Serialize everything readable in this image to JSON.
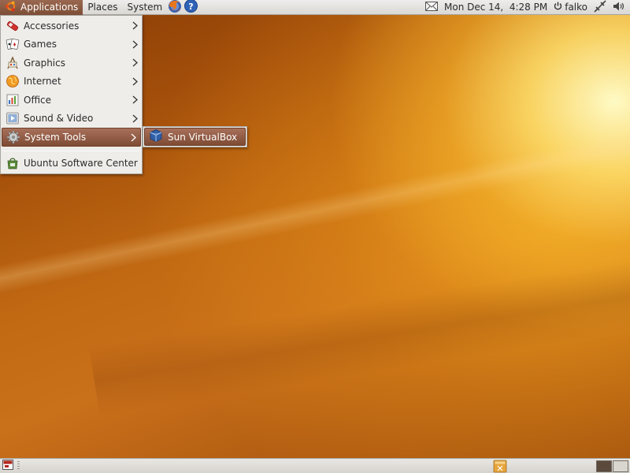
{
  "top_panel": {
    "applications_label": "Applications",
    "places_label": "Places",
    "system_label": "System",
    "firefox_icon": "firefox-icon",
    "help_icon": "help-icon",
    "mail_icon": "mail-icon",
    "clock": "Mon Dec 14,  4:28 PM",
    "user": "falko",
    "power_icon": "power-icon",
    "network_icon": "network-icon",
    "volume_icon": "volume-icon"
  },
  "applications_menu": {
    "items": [
      {
        "label": "Accessories",
        "icon": "accessories-icon",
        "has_submenu": true
      },
      {
        "label": "Games",
        "icon": "games-icon",
        "has_submenu": true
      },
      {
        "label": "Graphics",
        "icon": "graphics-icon",
        "has_submenu": true
      },
      {
        "label": "Internet",
        "icon": "internet-icon",
        "has_submenu": true
      },
      {
        "label": "Office",
        "icon": "office-icon",
        "has_submenu": true
      },
      {
        "label": "Sound & Video",
        "icon": "sound-video-icon",
        "has_submenu": true
      },
      {
        "label": "System Tools",
        "icon": "system-tools-icon",
        "has_submenu": true,
        "active": true
      }
    ],
    "footer_item": {
      "label": "Ubuntu Software Center",
      "icon": "software-center-icon"
    }
  },
  "system_tools_submenu": {
    "items": [
      {
        "label": "Sun VirtualBox",
        "icon": "virtualbox-icon"
      }
    ]
  },
  "bottom_panel": {
    "show_desktop_icon": "show-desktop-icon",
    "trash_icon": "trash-icon",
    "workspaces": [
      "workspace-1",
      "workspace-2"
    ]
  },
  "colors": {
    "menu_highlight": "#8f5a43",
    "panel": "#e4e2de",
    "menu_background": "#efedea"
  }
}
